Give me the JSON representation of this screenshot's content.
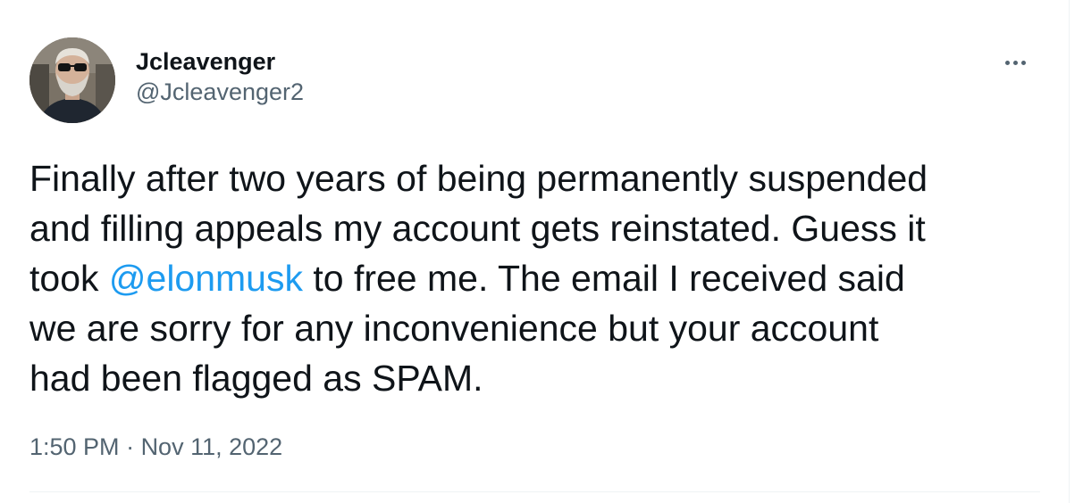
{
  "author": {
    "display_name": "Jcleavenger",
    "handle": "@Jcleavenger2",
    "avatar_alt": "profile photo"
  },
  "menu": {
    "more_icon": "more-horizontal-icon"
  },
  "tweet": {
    "line1": "Finally after two years of being permanently suspended",
    "line2": "and filling appeals my account gets reinstated. Guess it",
    "line3_before": "took ",
    "mention": "@elonmusk",
    "line3_after": " to free me. The email I received said",
    "line4": "we are sorry for any inconvenience but your account",
    "line5": "had been flagged as SPAM."
  },
  "meta": {
    "time": "1:50 PM",
    "separator": " · ",
    "date": "Nov 11, 2022"
  },
  "colors": {
    "link": "#1d9bf0",
    "secondary_text": "#536471",
    "primary_text": "#0f1419",
    "border": "#eff3f4"
  }
}
